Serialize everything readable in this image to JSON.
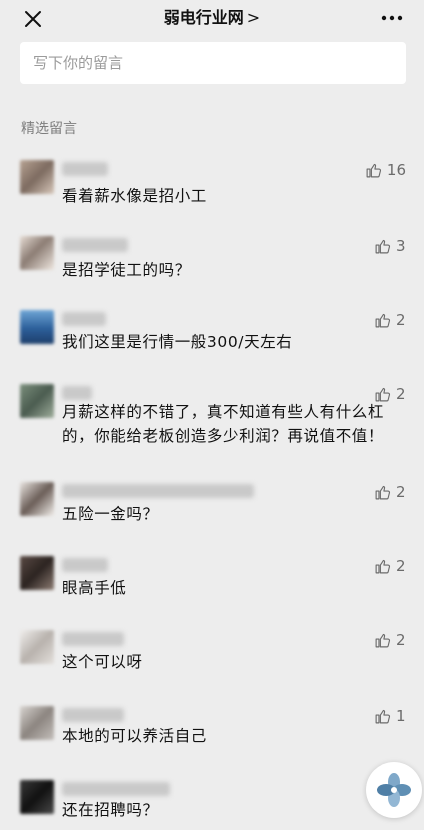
{
  "header": {
    "title": "弱电行业网",
    "chevron": ">",
    "more": "•••"
  },
  "comment_input": {
    "placeholder": "写下你的留言"
  },
  "section_label": "精选留言",
  "comments": [
    {
      "text": "看着薪水像是招小工",
      "likes": "16"
    },
    {
      "text": "是招学徒工的吗？",
      "likes": "3"
    },
    {
      "text": "我们这里是行情一般300/天左右",
      "likes": "2"
    },
    {
      "text": "月薪这样的不错了，真不知道有些人有什么杠的，你能给老板创造多少利润？再说值不值！",
      "likes": "2"
    },
    {
      "text": "五险一金吗？",
      "likes": "2"
    },
    {
      "text": "眼高手低",
      "likes": "2"
    },
    {
      "text": "这个可以呀",
      "likes": "2"
    },
    {
      "text": "本地的可以养活自己",
      "likes": "1"
    },
    {
      "text": "还在招聘吗？",
      "likes": ""
    }
  ]
}
